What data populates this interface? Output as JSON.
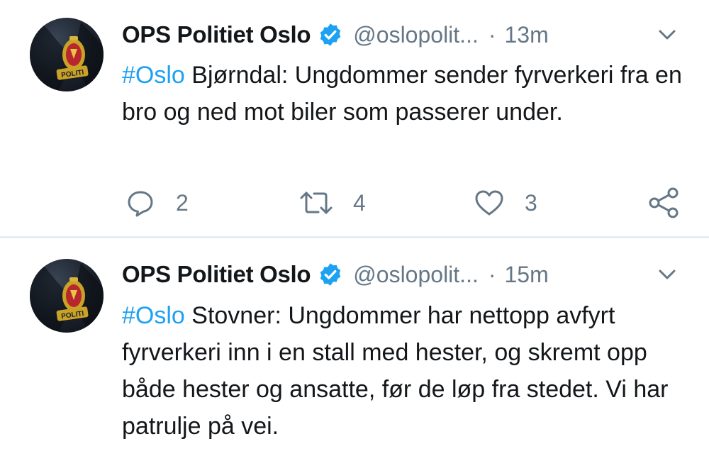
{
  "tweets": [
    {
      "author_name": "OPS Politiet Oslo",
      "handle": "@oslopolit...",
      "separator": "·",
      "time": "13m",
      "hashtag": "#Oslo",
      "text": " Bjørndal: Ungdommer sender fyrverkeri fra en bro og ned mot biler som passerer under.",
      "replies": "2",
      "retweets": "4",
      "likes": "3"
    },
    {
      "author_name": "OPS Politiet Oslo",
      "handle": "@oslopolit...",
      "separator": "·",
      "time": "15m",
      "hashtag": "#Oslo",
      "text": " Stovner: Ungdommer har nettopp avfyrt fyrverkeri inn i en stall med hester, og skremt opp både hester og ansatte, før de løp fra stedet. Vi har patrulje på vei."
    }
  ],
  "avatar": {
    "badge_text": "POLITI",
    "icon": "police-badge-icon"
  },
  "colors": {
    "accent": "#1da1f2",
    "text": "#14171a",
    "secondary": "#657786",
    "divider": "#e6ecf0",
    "verified": "#1da1f2"
  },
  "icons": {
    "verified": "verified-badge-icon",
    "caret": "chevron-down-icon",
    "reply": "reply-icon",
    "retweet": "retweet-icon",
    "like": "heart-icon",
    "share": "share-icon"
  }
}
